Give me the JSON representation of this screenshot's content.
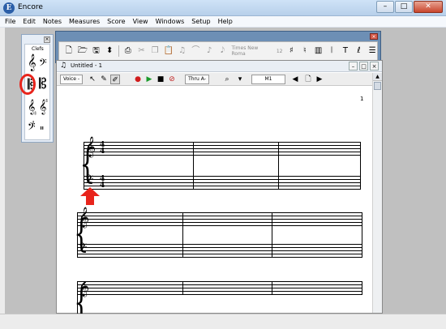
{
  "app": {
    "title": "Encore",
    "icon": "encore-app-icon",
    "window_buttons": [
      "–",
      "□",
      "✕"
    ]
  },
  "menubar": [
    "File",
    "Edit",
    "Notes",
    "Measures",
    "Score",
    "View",
    "Windows",
    "Setup",
    "Help"
  ],
  "clefs_palette": {
    "title": "Clefs",
    "items": [
      "treble-clef",
      "bass-clef",
      "alto-clef",
      "tenor-clef",
      "treble-8vb-clef",
      "treble-8va-clef",
      "bass-8vb-clef",
      "percussion-clef"
    ]
  },
  "toolbar": {
    "font_name": "Times New Roma",
    "font_size": "12",
    "icons": [
      "new-document-icon",
      "open-folder-icon",
      "save-icon",
      "page-setup-icon",
      "print-icon",
      "cut-icon",
      "copy-icon",
      "paste-icon",
      "beam-icon",
      "slur-icon",
      "tie-icon",
      "grace-note-icon",
      "transpose-icon",
      "key-signature-icon",
      "time-signature-icon",
      "measure-icon",
      "text-icon",
      "lyrics-icon",
      "flag-icon"
    ]
  },
  "document": {
    "title": "Untitled - 1",
    "voice_label": "Voice -",
    "thru_label": "Thru A-",
    "measure_field": "M1",
    "page_number": "1",
    "time_signature": {
      "numerator": "4",
      "denominator": "4"
    }
  },
  "colors": {
    "highlight": "#e8241c",
    "toolbar_frame": "#6d8fb5"
  }
}
